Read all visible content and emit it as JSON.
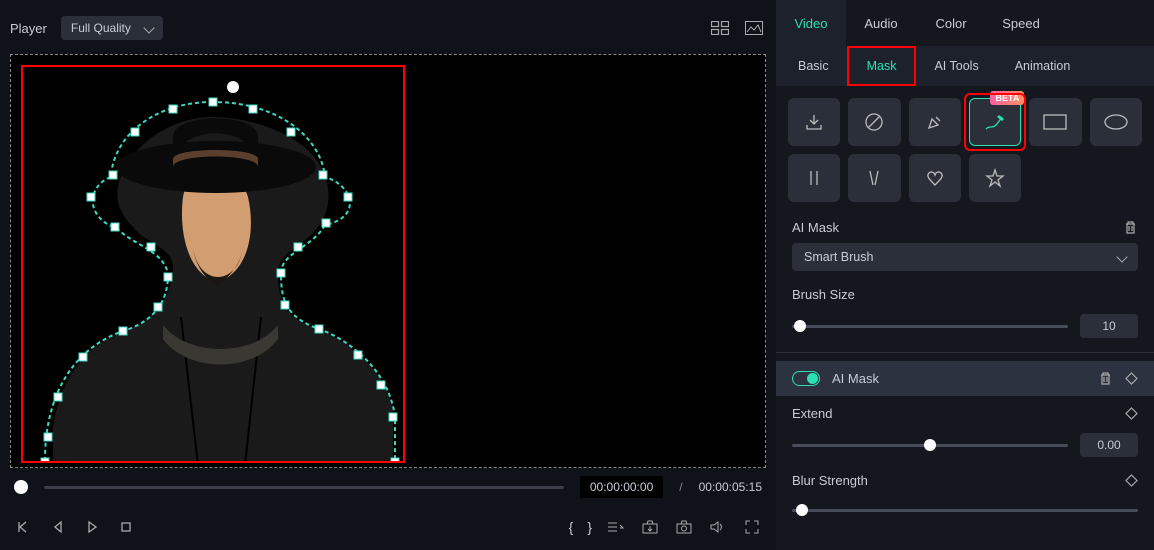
{
  "top": {
    "player_label": "Player",
    "quality": "Full Quality",
    "time_current": "00:00:00:00",
    "time_duration": "00:00:05:15",
    "time_sep": "/"
  },
  "tabs": [
    "Video",
    "Audio",
    "Color",
    "Speed"
  ],
  "active_tab": "Video",
  "subtabs": [
    "Basic",
    "Mask",
    "AI Tools",
    "Animation"
  ],
  "active_subtab": "Mask",
  "mask_tools": {
    "beta_label": "BETA"
  },
  "ai_mask": {
    "title": "AI Mask",
    "dropdown": "Smart Brush"
  },
  "brush_size": {
    "label": "Brush Size",
    "value": "10",
    "position_pct": 3
  },
  "ai_mask_row": {
    "label": "AI Mask",
    "toggle": true
  },
  "extend": {
    "label": "Extend",
    "value": "0.00",
    "position_pct": 50
  },
  "blur": {
    "label": "Blur Strength",
    "active_pct": 3
  }
}
